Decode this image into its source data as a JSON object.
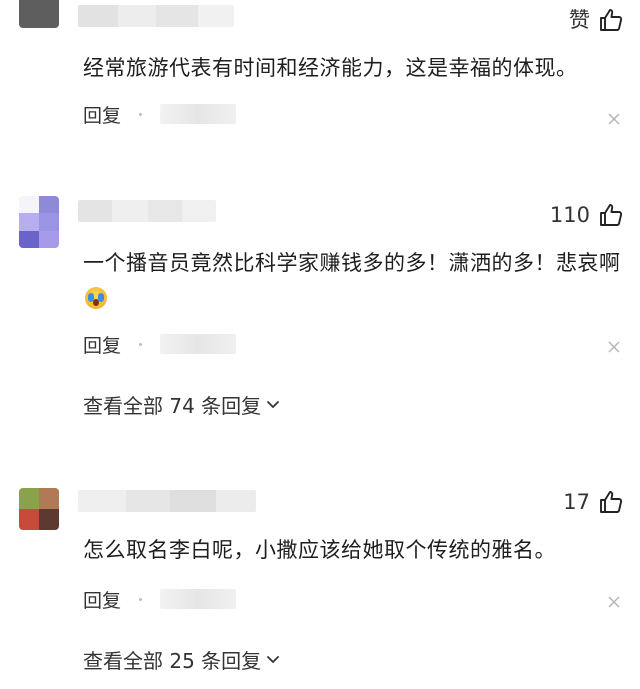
{
  "comments": [
    {
      "likes": "赞",
      "text": "经常旅游代表有时间和经济能力，这是幸福的体现。",
      "reply_label": "回复",
      "show_replies": null
    },
    {
      "likes": "110",
      "text": "一个播音员竟然比科学家赚钱多的多！潇洒的多！悲哀啊",
      "reply_label": "回复",
      "show_replies": "查看全部 74 条回复"
    },
    {
      "likes": "17",
      "text": "怎么取名李白呢，小撒应该给她取个传统的雅名。",
      "reply_label": "回复",
      "show_replies": "查看全部 25 条回复"
    }
  ],
  "icons": {
    "like": "thumbs-up-icon",
    "close": "close-icon",
    "expand": "chevron-down-icon",
    "emoji": "crying-face-emoji"
  },
  "colors": {
    "text": "#1e1e1e",
    "secondary": "#333333",
    "blur": "#e6e6e6",
    "avatar2_primary": "#a59be8",
    "avatar3_green": "#8aa24a",
    "avatar3_red": "#c74a3b"
  }
}
